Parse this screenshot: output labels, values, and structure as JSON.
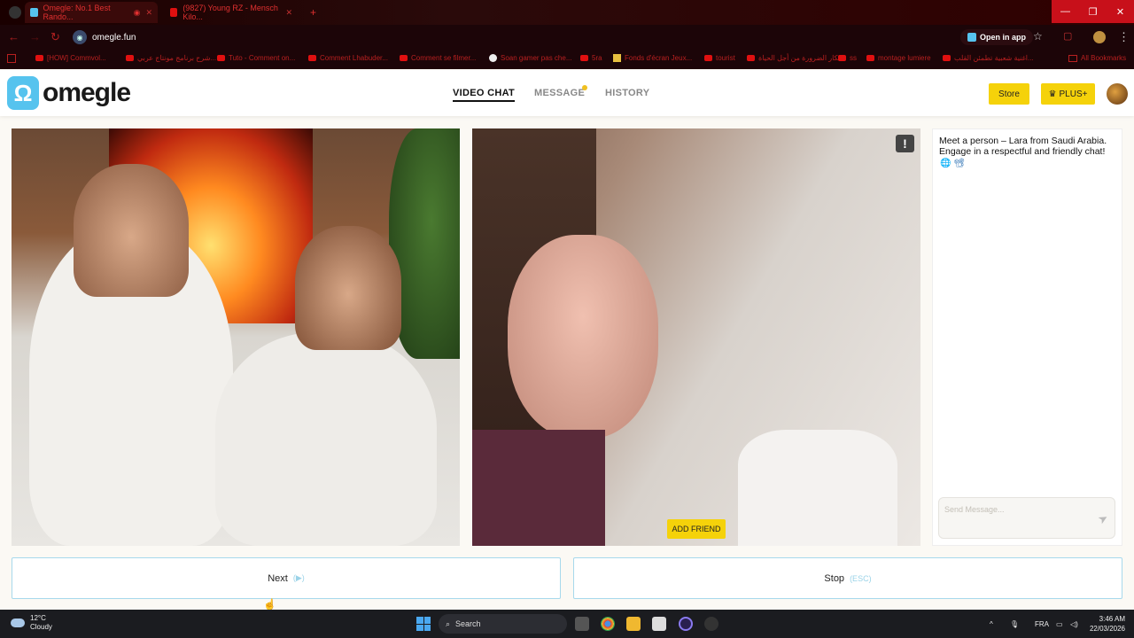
{
  "browser": {
    "tabs": [
      {
        "title": "Omegle: No.1 Best Rando..."
      },
      {
        "title": "(9827) Young RZ - Mensch Kilo..."
      }
    ],
    "new_tab_symbol": "+",
    "window_controls": [
      "—",
      "❐",
      "✕"
    ],
    "url": "omegle.fun",
    "open_in_app": "Open in app",
    "bookmarks": [
      "[HOW] Commvol...",
      "شرح برنامج مونتاج عربي...",
      "Tuto - Comment on...",
      "Comment Lhabuder...",
      "Comment se filmer...",
      "Soan gamer pas che...",
      "5ra",
      "Fonds d'écran Jeux...",
      "tourist",
      "ابتكار الضرورة من أجل الحياة",
      "ss",
      "montage lumiere",
      "اغنية شعبية تطمئن القلب...",
      "All Bookmarks"
    ]
  },
  "site": {
    "logo_text": "omegle",
    "logo_mark": "Ω",
    "nav": {
      "video_chat": "VIDEO CHAT",
      "message": "MESSAGE",
      "history": "HISTORY"
    },
    "store": "Store",
    "plus": "PLUS+",
    "plus_icon": "♛"
  },
  "video": {
    "report_symbol": "!",
    "add_friend": "ADD FRIEND"
  },
  "chat": {
    "message": "Meet a person – Lara from Saudi Arabia. Engage in a respectful and friendly chat!",
    "icons": "🌐 📽",
    "placeholder": "Send Message..."
  },
  "controls": {
    "next_label": "Next",
    "next_hint": "(▶)",
    "stop_label": "Stop",
    "stop_hint": "(ESC)"
  },
  "taskbar": {
    "temperature": "12°C",
    "weather": "Cloudy",
    "search": "Search",
    "language": "FRA",
    "time": "3:46 AM",
    "date": "22/03/2026"
  },
  "colors": {
    "accent_yellow": "#f5d20a",
    "logo_blue": "#56c3ee",
    "button_border": "#a7d9ec"
  }
}
